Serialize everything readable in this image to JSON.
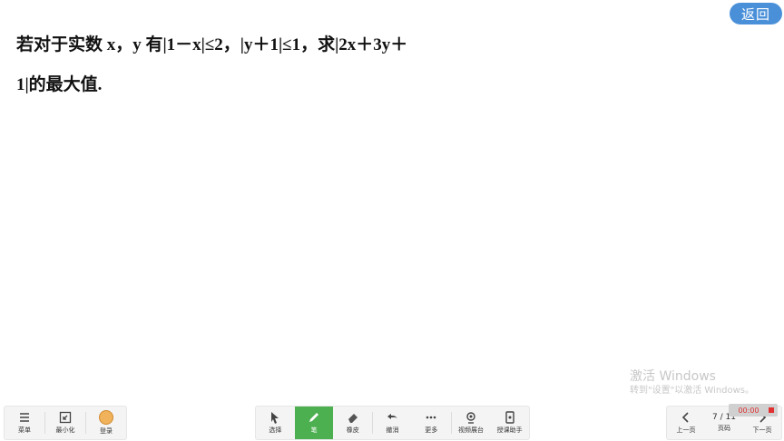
{
  "back_button": "返回",
  "problem": {
    "line1": "若对于实数 x，y 有|1－x|≤2，|y＋1|≤1，求|2x＋3y＋",
    "line2": "1|的最大值."
  },
  "watermark": {
    "title": "激活 Windows",
    "subtitle": "转到\"设置\"以激活 Windows。"
  },
  "toolbar_left": {
    "menu": "菜单",
    "minimize": "最小化",
    "login": "登录"
  },
  "toolbar_center": {
    "select": "选择",
    "pen": "笔",
    "eraser": "橡皮",
    "undo": "撤消",
    "more": "更多",
    "video": "视频展台",
    "assistant": "授课助手"
  },
  "toolbar_right": {
    "prev": "上一页",
    "page_label": "页码",
    "page_value": "7 / 11",
    "next": "下一页"
  },
  "timer": "00:00",
  "colors": {
    "accent": "#4a90d9",
    "pen_active": "#4caf50"
  }
}
